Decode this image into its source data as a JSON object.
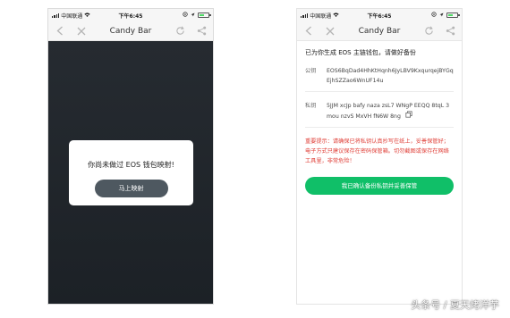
{
  "status_bar": {
    "carrier": "中国联通",
    "time": "下午6:45"
  },
  "nav": {
    "title": "Candy Bar"
  },
  "left_screen": {
    "dialog": {
      "message": "你尚未做过 EOS 钱包映射!",
      "button_label": "马上映射"
    }
  },
  "right_screen": {
    "heading": "已为你生成 EOS 主链钱包，请做好备份",
    "public_key": {
      "label": "公钥",
      "value": "EOS6BqDad4HhKtHqnh6JyLBV9KxqurqejBYGqEjhSZZao6WnUF14u"
    },
    "private_key": {
      "label": "私钥",
      "value": "5JJM xcJp bafy naza zsL7 WNgP EEQQ 8tqL 3mou nzvS MxVH fN6W 8ng"
    },
    "warning": "重要提示：请确保已将私钥认真抄写在纸上，妥善保管好；电子方式只建议保存在密码保管箱。切勿截图或保存在网络工具里，非常危险！",
    "confirm_button": "我已确认备份私钥并妥善保管"
  },
  "watermark": "头条号 / 夏天烤洋芋",
  "colors": {
    "primary_green": "#10bf68",
    "warning_red": "#e0413a",
    "dark_bg": "#21262c",
    "dialog_button": "#4e5860"
  }
}
